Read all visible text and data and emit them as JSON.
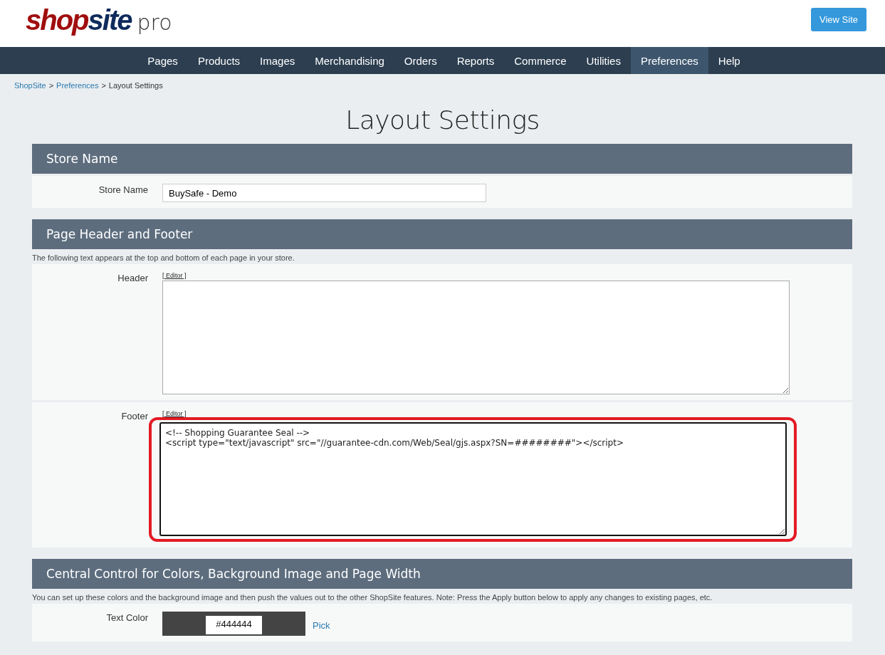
{
  "logo": {
    "shop": "shop",
    "site": "site",
    "suffix": "pro"
  },
  "view_site_button": "View Site",
  "nav": [
    {
      "label": "Pages",
      "selected": false
    },
    {
      "label": "Products",
      "selected": false
    },
    {
      "label": "Images",
      "selected": false
    },
    {
      "label": "Merchandising",
      "selected": false
    },
    {
      "label": "Orders",
      "selected": false
    },
    {
      "label": "Reports",
      "selected": false
    },
    {
      "label": "Commerce",
      "selected": false
    },
    {
      "label": "Utilities",
      "selected": false
    },
    {
      "label": "Preferences",
      "selected": true
    },
    {
      "label": "Help",
      "selected": false
    }
  ],
  "breadcrumb": {
    "links": [
      "ShopSite",
      "Preferences"
    ],
    "current": "Layout Settings",
    "separator": ">"
  },
  "page_title": "Layout Settings",
  "sections": [
    {
      "title": "Store Name",
      "rows": [
        {
          "kind": "input",
          "label": "Store Name",
          "value": "BuySafe - Demo"
        }
      ]
    },
    {
      "title": "Page Header and Footer",
      "description": "The following text appears at the top and bottom of each page in your store.",
      "rows": [
        {
          "kind": "textarea",
          "label": "Header",
          "editor_link": "[ Editor ]",
          "value": "",
          "highlighted": false
        },
        {
          "kind": "textarea",
          "label": "Footer",
          "editor_link": "[ Editor ]",
          "value": "<!-- Shopping Guarantee Seal -->\n<script type=\"text/javascript\" src=\"//guarantee-cdn.com/Web/Seal/gjs.aspx?SN=########\"></script>",
          "highlighted": true
        }
      ]
    },
    {
      "title": "Central Control for Colors, Background Image and Page Width",
      "description": "You can set up these colors and the background image and then push the values out to the other ShopSite features. Note: Press the Apply button below to apply any changes to existing pages, etc.",
      "rows": [
        {
          "kind": "color",
          "label": "Text Color",
          "value": "#444444",
          "color": "#444444",
          "pick_link": "Pick"
        }
      ]
    }
  ]
}
